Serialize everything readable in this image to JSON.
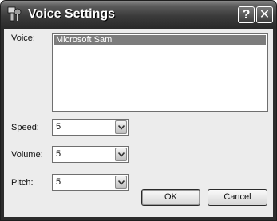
{
  "window": {
    "title": "Voice Settings"
  },
  "titlebar": {
    "help_glyph": "?",
    "close_glyph": "✕"
  },
  "voice": {
    "label": "Voice:",
    "items": [
      "Microsoft Sam"
    ],
    "selected": "Microsoft Sam"
  },
  "speed": {
    "label": "Speed:",
    "value": "5"
  },
  "volume": {
    "label": "Volume:",
    "value": "5"
  },
  "pitch": {
    "label": "Pitch:",
    "value": "5"
  },
  "buttons": {
    "ok": "OK",
    "cancel": "Cancel"
  },
  "icons": {
    "app": "speaker-settings-icon",
    "help": "help-icon",
    "close": "close-icon",
    "dropdown": "chevron-down-icon"
  }
}
